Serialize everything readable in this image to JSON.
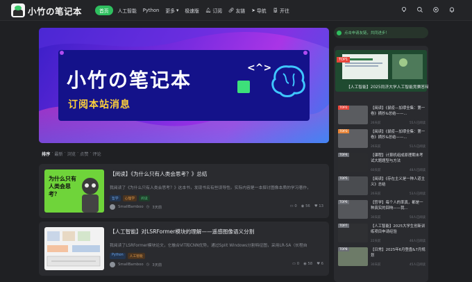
{
  "site": {
    "name": "小竹の笔记本"
  },
  "nav": {
    "items": [
      {
        "label": "首页",
        "active": true
      },
      {
        "label": "人工智能"
      },
      {
        "label": "Python"
      },
      {
        "label": "更多",
        "dropdown": true
      },
      {
        "label": "极速版"
      },
      {
        "label": "订阅"
      },
      {
        "label": "友链"
      },
      {
        "label": "导航"
      },
      {
        "label": "开往"
      }
    ],
    "right_icons": [
      "light-bulb-icon",
      "search-icon",
      "settings-icon",
      "bell-icon"
    ]
  },
  "banner": {
    "title": "小竹の笔记本",
    "symbol": "<^>",
    "subtitle": "订阅本站消息"
  },
  "tabs": {
    "items": [
      "排序",
      "最新",
      "浏览",
      "点赞",
      "评论"
    ],
    "separator": "·"
  },
  "posts": [
    {
      "title": "【阅读】《为什么只有人类会思考？》总结",
      "excerpt": "我阅读了《为什么只有人类会思考？》这本书，发现书名有些误导性。实际内容是一本探讨图像本质的学习著作，",
      "thumb_text": "为什么只有人类会思考？",
      "tags": [
        {
          "label": "哲学",
          "color": "blue"
        },
        {
          "label": "心理学",
          "color": "orange"
        },
        {
          "label": "阅读",
          "color": "green"
        }
      ],
      "author": "SmallBamboo",
      "time": "3天前",
      "comments": "0",
      "views": "56",
      "likes": "13"
    },
    {
      "title": "【人工智能】对LSRFormer模块的理解——遥感图像语义分割",
      "excerpt": "我阅读了LSRFormer模块论文，它融合ViT和CNN优势，通过Split Windows分割特征图，采用LR-SA（长程自",
      "tags": [
        {
          "label": "Python",
          "color": "blue"
        },
        {
          "label": "人工智能",
          "color": "orange"
        }
      ],
      "author": "SmallBamboo",
      "time": "3天前",
      "comments": "0",
      "views": "58",
      "likes": "6"
    }
  ],
  "sidebar": {
    "notice": "点击申请友链，共同进步！",
    "featured": {
      "badge": "TOP1",
      "title": "【人工智能】2025同济大学人工智能竞赛答辩总结"
    },
    "items": [
      {
        "badge": "TOP2",
        "badge_color": "#e8463b",
        "title": "【阅读】《鼠疫—加缪全集：第一卷》摘抄&总结——...",
        "date": "26天前",
        "views": "55人已阅读"
      },
      {
        "badge": "TOP3",
        "badge_color": "#e9863a",
        "title": "【阅读】《鼠疫—加缪全集：第一卷》摘抄&总结——...",
        "date": "26天前",
        "views": "51人已阅读"
      },
      {
        "badge": "TOP4",
        "badge_color": "#6b6e75",
        "title": "【课程】计算机组成原理期末考试大题题型与方法",
        "date": "60天前",
        "views": "48人已阅读"
      },
      {
        "badge": "TOP5",
        "badge_color": "#6b6e75",
        "title": "【阅读】《存在主义是一种人道主义》总结",
        "date": "26天前",
        "views": "53人已阅读"
      },
      {
        "badge": "TOP6",
        "badge_color": "#6b6e75",
        "title": "【哲学】每个人的率真，都是一种真实的回响——我...",
        "date": "30天前",
        "views": "50人已阅读"
      },
      {
        "badge": "TOP7",
        "badge_color": "#6b6e75",
        "title": "【人工智能】2025大学生创新训练项目申请经验",
        "date": "22天前",
        "views": "46人已阅读"
      },
      {
        "badge": "TOP8",
        "badge_color": "#6b6e75",
        "title": "【日常】2025年6月登盘&7月规划",
        "date": "30天前",
        "views": "45人已阅读"
      }
    ]
  },
  "colors": {
    "accent": "#2fbf5f",
    "background": "#1f2023",
    "card": "#2a2b2f"
  }
}
